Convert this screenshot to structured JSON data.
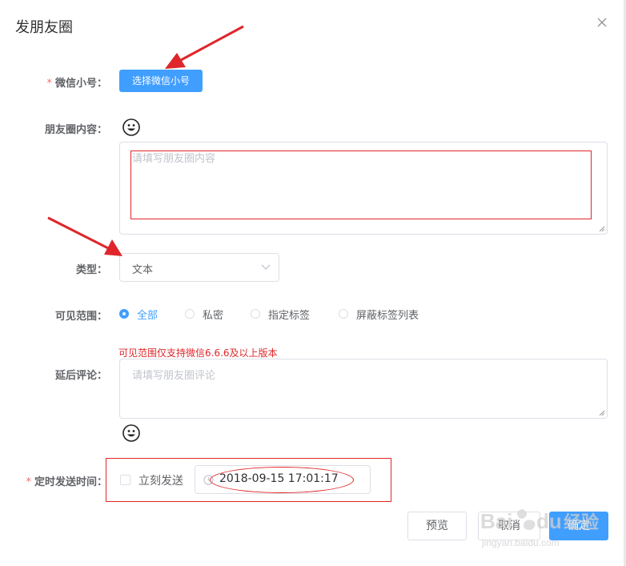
{
  "dialog": {
    "title": "发朋友圈"
  },
  "form": {
    "wechat": {
      "label": "微信小号：",
      "required_mark": "*",
      "button": "选择微信小号"
    },
    "content": {
      "label": "朋友圈内容：",
      "placeholder": "请填写朋友圈内容",
      "emoji_icon": "smiley-icon"
    },
    "type": {
      "label": "类型：",
      "value": "文本"
    },
    "visibility": {
      "label": "可见范围：",
      "options": [
        "全部",
        "私密",
        "指定标签",
        "屏蔽标签列表"
      ],
      "selected": "全部",
      "note": "可见范围仅支持微信6.6.6及以上版本"
    },
    "comment": {
      "label": "延后评论：",
      "placeholder": "请填写朋友圈评论"
    },
    "schedule": {
      "label": "定时发送时间：",
      "required_mark": "*",
      "checkbox_label": "立刻发送",
      "datetime": "2018-09-15 17:01:17"
    }
  },
  "footer": {
    "preview": "预览",
    "cancel": "取消",
    "confirm": "确定"
  },
  "watermark": {
    "text": "Bai du 经验",
    "sub": "jingyan.baidu.com"
  },
  "colors": {
    "primary": "#409eff",
    "annotation": "#e0262a",
    "required": "#f56c6c"
  }
}
